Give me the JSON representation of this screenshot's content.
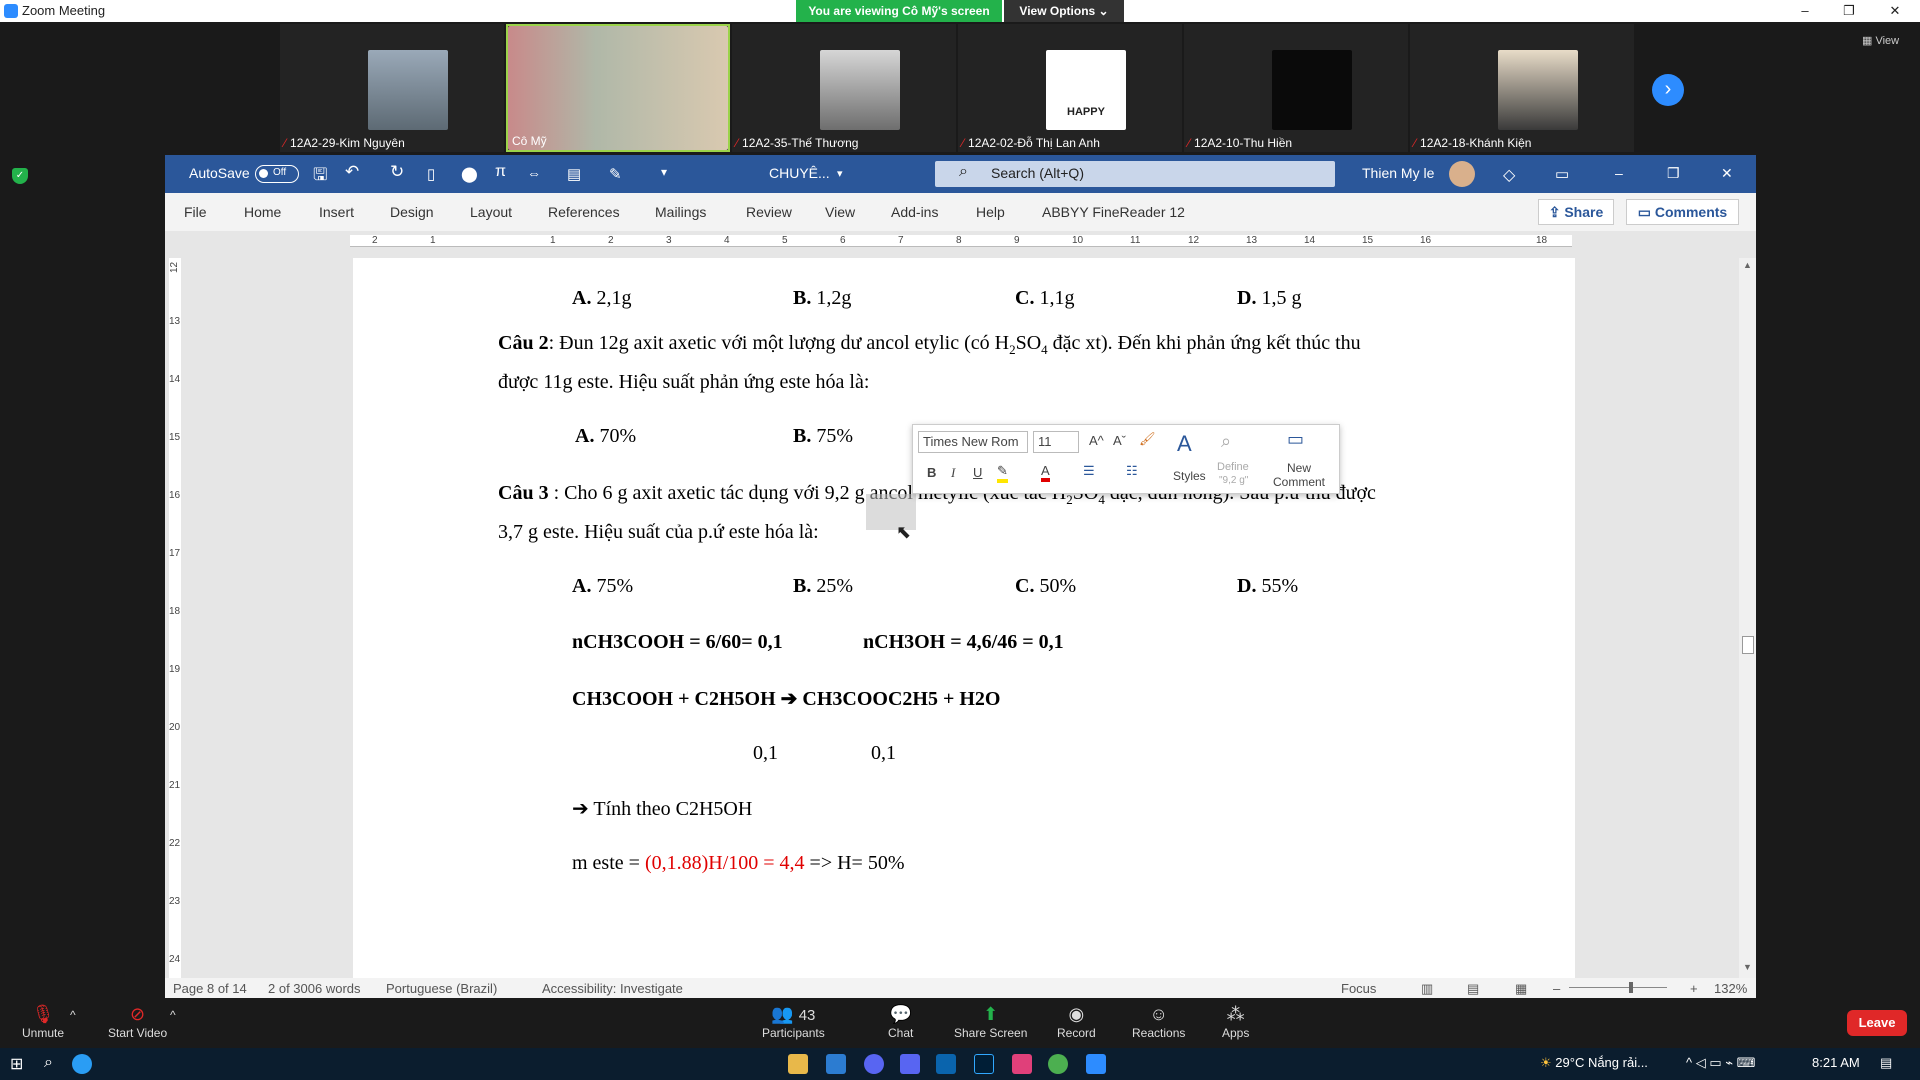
{
  "zoom": {
    "window_title": "Zoom Meeting",
    "viewing_banner": "You are viewing Cô Mỹ's screen",
    "view_options": "View Options",
    "view_label": "View",
    "participants": [
      {
        "name": "12A2-29-Kim Nguyên",
        "muted": true
      },
      {
        "name": "Cô Mỹ",
        "muted": false
      },
      {
        "name": "12A2-35-Thế Thương",
        "muted": true
      },
      {
        "name": "12A2-02-Đỗ Thị Lan Anh",
        "muted": true
      },
      {
        "name": "12A2-10-Thu Hiền",
        "muted": true
      },
      {
        "name": "12A2-18-Khánh Kiện",
        "muted": true
      }
    ],
    "happy_text": "HAPPY",
    "bottom": {
      "unmute": "Unmute",
      "start_video": "Start Video",
      "participants": "Participants",
      "participant_count": "43",
      "chat": "Chat",
      "share_screen": "Share Screen",
      "record": "Record",
      "reactions": "Reactions",
      "apps": "Apps",
      "leave": "Leave"
    }
  },
  "word": {
    "autosave": "AutoSave",
    "autosave_state": "Off",
    "doc_title": "CHUYÊ...",
    "search_placeholder": "Search (Alt+Q)",
    "user": "Thien My le",
    "tabs": [
      "File",
      "Home",
      "Insert",
      "Design",
      "Layout",
      "References",
      "Mailings",
      "Review",
      "View",
      "Add-ins",
      "Help",
      "ABBYY FineReader 12"
    ],
    "share": "Share",
    "comments": "Comments",
    "ruler_numbers": [
      "2",
      "1",
      "1",
      "2",
      "3",
      "4",
      "5",
      "6",
      "7",
      "8",
      "9",
      "10",
      "11",
      "12",
      "13",
      "14",
      "15",
      "16",
      "18"
    ],
    "vruler_numbers": [
      "12",
      "13",
      "14",
      "15",
      "16",
      "17",
      "18",
      "19",
      "20",
      "21",
      "22",
      "23",
      "24"
    ],
    "mini_toolbar": {
      "font_name": "Times New Rom",
      "font_size": "11",
      "styles": "Styles",
      "define": "Define",
      "define_sub": "\"9,2 g\"",
      "new_comment_1": "New",
      "new_comment_2": "Comment"
    },
    "status": {
      "page": "Page 8 of 14",
      "words": "2 of 3006 words",
      "language": "Portuguese (Brazil)",
      "accessibility": "Accessibility: Investigate",
      "focus": "Focus",
      "zoom": "132%"
    },
    "doc": {
      "q1_answers": [
        {
          "l": "A.",
          "v": " 2,1g"
        },
        {
          "l": "B.",
          "v": " 1,2g"
        },
        {
          "l": "C.",
          "v": " 1,1g"
        },
        {
          "l": "D.",
          "v": " 1,5 g"
        }
      ],
      "q2_label": "Câu 2",
      "q2_text1": ": Đun 12g axit axetic với một lượng dư ancol etylic (có H",
      "q2_sub1": "2",
      "q2_text2": "SO",
      "q2_sub2": "4",
      "q2_text3": " đặc xt). Đến khi phản ứng kết thúc thu",
      "q2_line2": "được 11g este. Hiệu suất phản ứng este hóa là:",
      "q2_answers": [
        {
          "l": "A.",
          "v": " 70%"
        },
        {
          "l": "B.",
          "v": " 75%"
        }
      ],
      "q3_label": "Câu 3",
      "q3_text1": " : Cho 6 g axit axetic tác dụng với 9,2 g ancol metylic (xúc tác H",
      "q3_sub1": "2",
      "q3_text2": "SO",
      "q3_sub2": "4",
      "q3_text3": " đặc, đun nóng). Sau p.ứ thu được",
      "q3_line2": "3,7 g este. Hiệu suất của p.ứ este hóa là:",
      "q3_answers": [
        {
          "l": "A.",
          "v": " 75%"
        },
        {
          "l": "B.",
          "v": " 25%"
        },
        {
          "l": "C.",
          "v": " 50%"
        },
        {
          "l": "D.",
          "v": " 55%"
        }
      ],
      "calc1a": "nCH3COOH = 6/60= 0,1",
      "calc1b": "nCH3OH = 4,6/46 = 0,1",
      "eq_left": "CH3COOH  +  C2H5OH ",
      "eq_arrow": "➔",
      "eq_right": " CH3COOC2H5 + H2O",
      "mol1": "0,1",
      "mol2": "0,1",
      "arrow_line": "➔ Tính theo C2H5OH",
      "m_este_1": "m este = ",
      "m_este_red": "(0,1.88)H/100 = 4,4",
      "m_este_2": " => H= 50%"
    }
  },
  "taskbar": {
    "weather": "29°C  Nắng rải...",
    "time": "8:21 AM"
  },
  "colors": {
    "word_blue": "#2b579a",
    "zoom_green": "#23b24b",
    "zoom_blue": "#2d8cff",
    "leave_red": "#e02828"
  }
}
